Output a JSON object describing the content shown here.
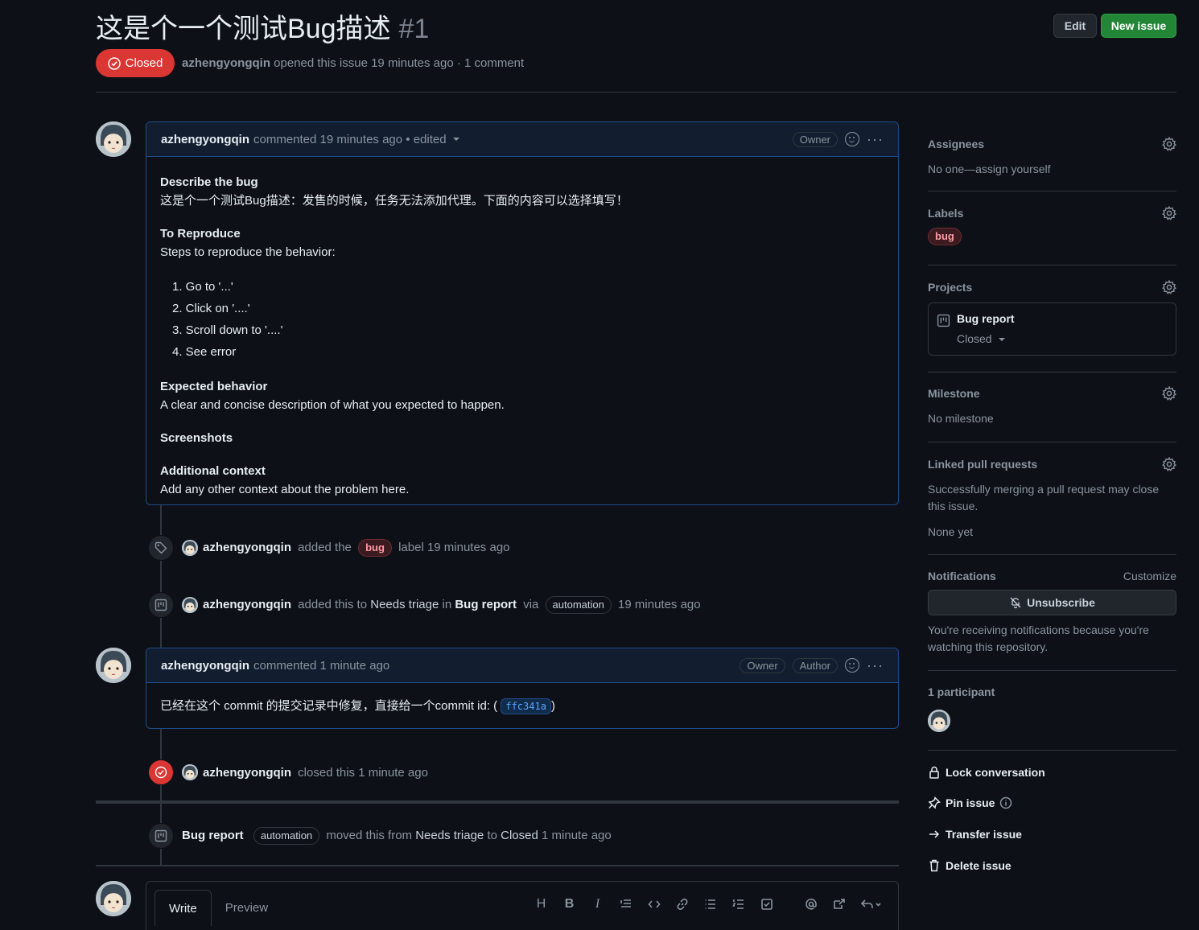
{
  "header": {
    "title": "这是个一个测试Bug描述",
    "number": "#1",
    "edit_label": "Edit",
    "new_issue_label": "New issue",
    "state_label": "Closed",
    "author": "azhengyongqin",
    "meta_text": "opened this issue 19 minutes ago · 1 comment"
  },
  "comment1": {
    "author": "azhengyongqin",
    "meta": "commented 19 minutes ago • edited",
    "badge": "Owner",
    "sections": {
      "describe_title": "Describe the bug",
      "describe_text": "这是个一个测试Bug描述：发售的时候，任务无法添加代理。下面的内容可以选择填写！",
      "reproduce_title": "To Reproduce",
      "reproduce_text": "Steps to reproduce the behavior:",
      "steps": [
        "1. Go to '...'",
        "2. Click on '....'",
        "3. Scroll down to '....'",
        "4. See error"
      ],
      "expected_title": "Expected behavior",
      "expected_text": "A clear and concise description of what you expected to happen.",
      "screenshots_title": "Screenshots",
      "context_title": "Additional context",
      "context_text": "Add any other context about the problem here."
    }
  },
  "event_label": {
    "actor": "azhengyongqin",
    "pre": "added the",
    "label": "bug",
    "post": "label 19 minutes ago"
  },
  "event_project": {
    "actor": "azhengyongqin",
    "pre": "added this to",
    "column": "Needs triage",
    "mid": "in",
    "project": "Bug report",
    "via": "via",
    "bot": "automation",
    "time": "19 minutes ago"
  },
  "comment2": {
    "author": "azhengyongqin",
    "meta": "commented 1 minute ago",
    "badge_owner": "Owner",
    "badge_author": "Author",
    "text": "已经在这个 commit 的提交记录中修复，直接给一个commit id: (",
    "commit": "ffc341a",
    "text_end": ")"
  },
  "event_closed": {
    "actor": "azhengyongqin",
    "text": "closed this 1 minute ago"
  },
  "event_moved": {
    "project": "Bug report",
    "bot": "automation",
    "pre": "moved this from",
    "from": "Needs triage",
    "to_word": "to",
    "to": "Closed",
    "time": "1 minute ago"
  },
  "editor": {
    "tab_write": "Write",
    "tab_preview": "Preview",
    "tool_heading": "H",
    "tool_bold": "B",
    "tool_italic": "I"
  },
  "sidebar": {
    "assignees_title": "Assignees",
    "assignees_value": "No one—assign yourself",
    "labels_title": "Labels",
    "label_bug": "bug",
    "projects_title": "Projects",
    "project_name": "Bug report",
    "project_status": "Closed",
    "milestone_title": "Milestone",
    "milestone_value": "No milestone",
    "linked_title": "Linked pull requests",
    "linked_text": "Successfully merging a pull request may close this issue.",
    "linked_value": "None yet",
    "notifications_title": "Notifications",
    "customize": "Customize",
    "unsubscribe": "Unsubscribe",
    "notif_text": "You're receiving notifications because you're watching this repository.",
    "participants_title": "1 participant",
    "lock": "Lock conversation",
    "pin": "Pin issue",
    "transfer": "Transfer issue",
    "delete": "Delete issue"
  },
  "colors": {
    "background": "#0d1117",
    "closed_red": "#da3633",
    "new_issue_green": "#238636",
    "comment_border": "#1f4b8a",
    "comment_header": "#121d2f"
  }
}
